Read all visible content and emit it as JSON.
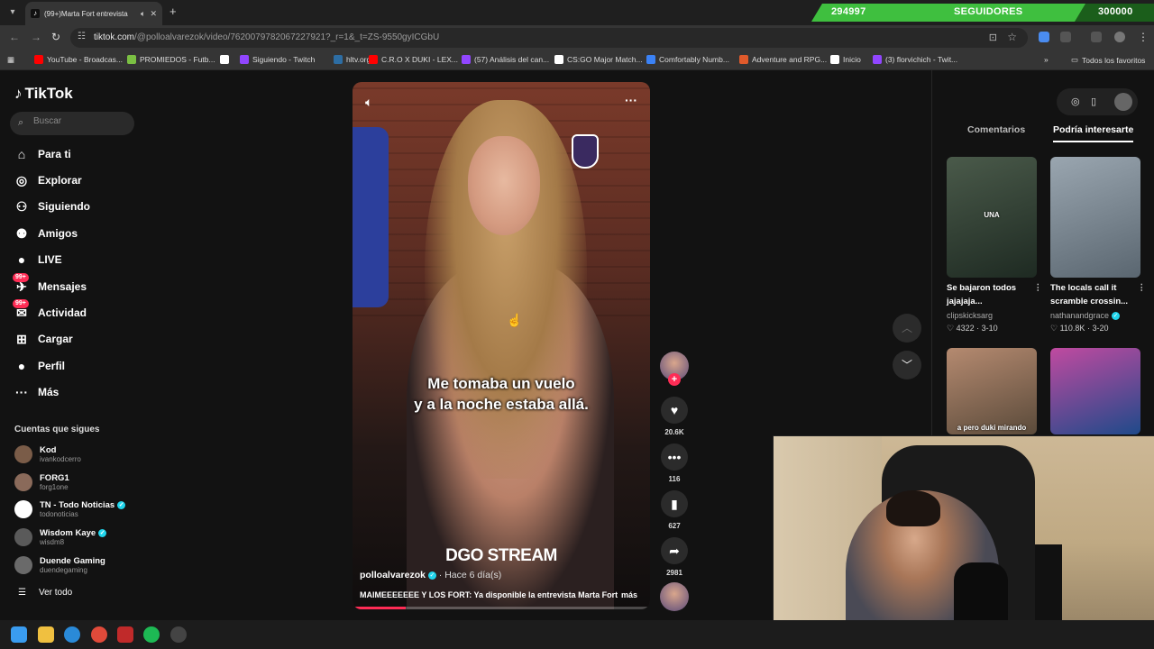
{
  "browser": {
    "tab_title": "(99+)Marta Fort entrevista",
    "url_host": "tiktok.com",
    "url_path": "/@polloalvarezok/video/7620079782067227921?_r=1&_t=ZS-9550gyICGbU",
    "bookmarks": [
      {
        "label": "YouTube - Broadcas...",
        "color": "#ff0000"
      },
      {
        "label": "PROMIEDOS - Futb...",
        "color": "#7bc043"
      },
      {
        "label": "",
        "color": "#ffffff"
      },
      {
        "label": "Siguiendo - Twitch",
        "color": "#9146ff"
      },
      {
        "label": "hltv.org",
        "color": "#2d6da3"
      },
      {
        "label": "C.R.O X DUKI - LEX...",
        "color": "#ff0000"
      },
      {
        "label": "(57) Análisis del can...",
        "color": "#9146ff"
      },
      {
        "label": "CS:GO Major Match...",
        "color": "#ffffff"
      },
      {
        "label": "Comfortably Numb...",
        "color": "#3b82f6"
      },
      {
        "label": "Adventure and RPG...",
        "color": "#e05a2b"
      },
      {
        "label": "Inicio",
        "color": "#ffffff"
      },
      {
        "label": "(3) florvichich - Twit...",
        "color": "#9146ff"
      }
    ],
    "all_bookmarks_label": "Todos los favoritos"
  },
  "counter": {
    "current": "294997",
    "label": "SEGUIDORES",
    "goal": "300000",
    "progress": 0.8
  },
  "sidebar": {
    "logo": "TikTok",
    "search_placeholder": "Buscar",
    "nav": [
      {
        "label": "Para ti",
        "icon": "home-icon"
      },
      {
        "label": "Explorar",
        "icon": "compass-icon"
      },
      {
        "label": "Siguiendo",
        "icon": "following-icon"
      },
      {
        "label": "Amigos",
        "icon": "friends-icon"
      },
      {
        "label": "LIVE",
        "icon": "live-icon"
      },
      {
        "label": "Mensajes",
        "icon": "messages-icon",
        "badge": "99+"
      },
      {
        "label": "Actividad",
        "icon": "activity-icon",
        "badge": "99+"
      },
      {
        "label": "Cargar",
        "icon": "upload-icon"
      },
      {
        "label": "Perfil",
        "icon": "profile-icon"
      },
      {
        "label": "Más",
        "icon": "more-icon"
      }
    ],
    "following_title": "Cuentas que sigues",
    "following": [
      {
        "name": "Kod",
        "handle": "ivankodcerro",
        "verified": false,
        "color": "#7a5c48"
      },
      {
        "name": "FORG1",
        "handle": "forg1one",
        "verified": false,
        "color": "#8a6a5a"
      },
      {
        "name": "TN - Todo Noticias",
        "handle": "todonoticias",
        "verified": true,
        "color": "#ffffff"
      },
      {
        "name": "Wisdom Kaye",
        "handle": "wisdm8",
        "verified": true,
        "color": "#5a5a5a"
      },
      {
        "name": "Duende Gaming",
        "handle": "duendegaming",
        "verified": false,
        "color": "#6a6a6a"
      }
    ],
    "see_all": "Ver todo"
  },
  "video": {
    "caption_line1": "Me tomaba un vuelo",
    "caption_line2": "y a la noche estaba allá.",
    "watermark": "DGO STREAM",
    "author": "polloalvarezok",
    "ago": "Hace 6 día(s)",
    "description": "MAIMEEEEEEE Y LOS FORT: Ya disponible la entrevista Marta Fort",
    "more": "más",
    "progress": 0.18
  },
  "actions": {
    "likes": "20.6K",
    "comments": "116",
    "saves": "627",
    "shares": "2981"
  },
  "right_panel": {
    "tab_comments": "Comentarios",
    "tab_suggested": "Podría interesarte",
    "suggested": [
      {
        "title": "Se bajaron todos jajajaja...",
        "author": "clipskicksarg",
        "verified": false,
        "likes": "4322",
        "date": "3-10",
        "colors": [
          "#4a5a4a",
          "#1e2a22"
        ]
      },
      {
        "title": "The locals call it scramble crossin...",
        "author": "nathanandgrace",
        "verified": true,
        "likes": "110.8K",
        "date": "3-20",
        "colors": [
          "#9aa6b0",
          "#5a6670"
        ]
      },
      {
        "title": "",
        "author": "",
        "verified": false,
        "likes": "",
        "date": "",
        "colors": [
          "#b58a70",
          "#5a4a3a"
        ]
      },
      {
        "title": "",
        "author": "",
        "verified": false,
        "likes": "",
        "date": "",
        "colors": [
          "#c04aa0",
          "#1f4a8a"
        ]
      }
    ],
    "thumb_overlay_1": "UNA",
    "thumb_overlay_3": "a pero duki mirando"
  }
}
